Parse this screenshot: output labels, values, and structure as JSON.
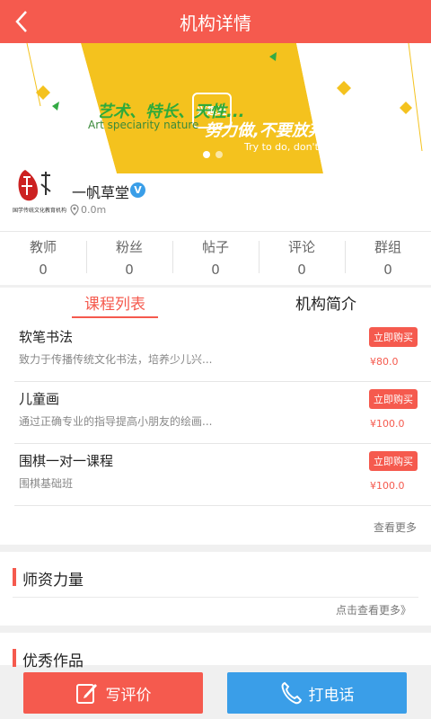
{
  "header": {
    "title": "机构详情",
    "back_icon": "chevron-left-icon"
  },
  "banner": {
    "logo_text": "兴趣班",
    "line1": "艺术、特长、天性...",
    "line2": "Art speciarity nature",
    "line3": "努力做,不要放弃!",
    "line4": "Try to do, don't give up....",
    "slide_count": 2,
    "active_slide": 1
  },
  "org": {
    "avatar_caption": "国学传统文化教育机构",
    "name": "一帆草堂",
    "verified_badge": "V",
    "distance": "0.0m"
  },
  "stats": [
    {
      "label": "教师",
      "value": "0"
    },
    {
      "label": "粉丝",
      "value": "0"
    },
    {
      "label": "帖子",
      "value": "0"
    },
    {
      "label": "评论",
      "value": "0"
    },
    {
      "label": "群组",
      "value": "0"
    }
  ],
  "tabs": {
    "courses": "课程列表",
    "intro": "机构简介"
  },
  "courses": [
    {
      "name": "软笔书法",
      "desc": "致力于传播传统文化书法，培养少儿兴...",
      "buy": "立即购买",
      "price": "¥80.0"
    },
    {
      "name": "儿童画",
      "desc": "通过正确专业的指导提高小朋友的绘画...",
      "buy": "立即购买",
      "price": "¥100.0"
    },
    {
      "name": "围棋一对一课程",
      "desc": "围棋基础班",
      "buy": "立即购买",
      "price": "¥100.0"
    }
  ],
  "courses_more": "查看更多",
  "teachers": {
    "title": "师资力量",
    "hint": "点击查看更多》"
  },
  "works": {
    "title": "优秀作品"
  },
  "actions": {
    "review": "写评价",
    "call": "打电话"
  },
  "colors": {
    "primary_red": "#f55a4e",
    "accent_blue": "#3a9ee8",
    "banner_yellow": "#f4c21e"
  }
}
